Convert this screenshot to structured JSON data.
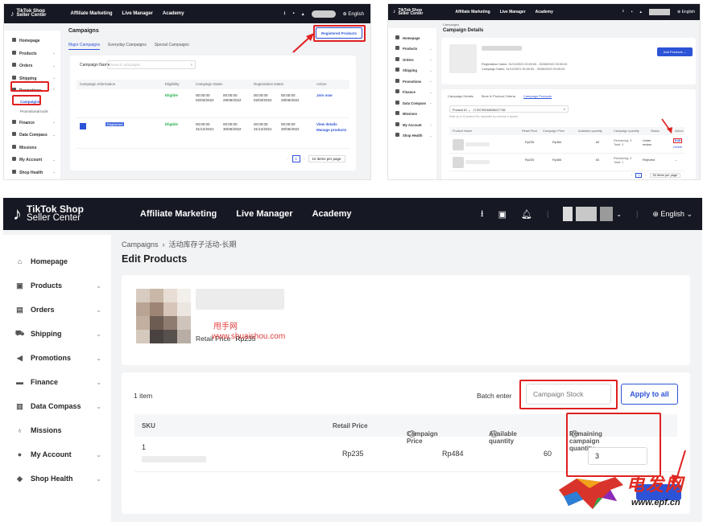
{
  "panel1": {
    "logo": {
      "line1": "TikTok Shop",
      "line2": "Seller Center"
    },
    "nav": [
      "Affiliate Marketing",
      "Live Manager",
      "Academy"
    ],
    "language": "English",
    "sidebar": [
      "Homepage",
      "Products",
      "Orders",
      "Shipping",
      "Promotions",
      "Finance",
      "Data Compass",
      "Missions",
      "My Account",
      "Shop Health"
    ],
    "sub_items": [
      "Campaigns",
      "Promotional tools"
    ],
    "title": "Campaigns",
    "registered_btn": "Registered Products",
    "tabs": [
      "Major Campaigns",
      "Everyday Campaigns",
      "Special Campaigns"
    ],
    "search_label": "Campaign Name",
    "search_placeholder": "Search campaigns",
    "columns": [
      "Campaign Information",
      "Eligibility",
      "Campaign Dates",
      "Registration Dates",
      "Action"
    ],
    "rows": [
      {
        "eligibility": "Eligible",
        "c_start": "00:00:00 02/03/2022",
        "c_end": "00:00:00 29/06/2022",
        "r_start": "00:00:00 02/03/2022",
        "r_end": "00:00:00 29/06/2022",
        "action": "Join now",
        "badge": ""
      },
      {
        "eligibility": "Eligible",
        "c_start": "00:00:00 31/12/2021",
        "c_end": "00:00:00 30/06/2022",
        "r_start": "00:00:00 31/12/2021",
        "r_end": "00:00:00 30/06/2022",
        "action": "View details",
        "action2": "Manage products",
        "badge": "Registered"
      }
    ],
    "page": "1",
    "per_page": "10 items per page"
  },
  "panel2": {
    "logo": {
      "line1": "TikTok Shop",
      "line2": "Seller Center"
    },
    "nav": [
      "Affiliate Marketing",
      "Live Manager",
      "Academy"
    ],
    "language": "English",
    "sidebar": [
      "Homepage",
      "Products",
      "Orders",
      "Shipping",
      "Promotions",
      "Finance",
      "Data Compass",
      "Missions",
      "My Account",
      "Shop Health"
    ],
    "breadcrumb": "Campaigns",
    "title": "Campaign Details",
    "reg_dates": "Registration Dates: 31/12/2021 00:00:00 - 30/06/2022 00:00:00",
    "camp_dates": "Campaign Dates: 31/12/2021 00:00:00 - 30/06/2022 00:00:00",
    "add_btn": "Add Products",
    "tabs": [
      "Campaign Details",
      "Store & Product Criteria",
      "Campaign Products"
    ],
    "filter_label": "Product ID",
    "filter_value": "1729749248636227738",
    "hint": "Enter up to 10 product IDs, separated by commas or spaces",
    "columns": [
      "Product Name",
      "Retail Price",
      "Campaign Price",
      "Available quantity",
      "Campaign quantity",
      "Status",
      "Action"
    ],
    "rows": [
      {
        "retail": "Rp235",
        "campaign": "Rp484",
        "available": "60",
        "remaining": "Remaining: 3 Total: 3",
        "status": "Under review",
        "action": "Edit",
        "action2": "Delete"
      },
      {
        "retail": "Rp235",
        "campaign": "Rp466",
        "available": "60",
        "remaining": "Remaining: 0 Total: 1",
        "status": "Rejected",
        "action": "--"
      }
    ],
    "page": "1",
    "per_page": "50 items per page"
  },
  "main": {
    "logo": {
      "line1": "TikTok Shop",
      "line2": "Seller Center"
    },
    "nav": [
      "Affiliate Marketing",
      "Live Manager",
      "Academy"
    ],
    "language": "English",
    "sidebar": [
      {
        "label": "Homepage",
        "icon": "home-icon",
        "chevron": false
      },
      {
        "label": "Products",
        "icon": "box-icon",
        "chevron": true
      },
      {
        "label": "Orders",
        "icon": "list-icon",
        "chevron": true
      },
      {
        "label": "Shipping",
        "icon": "truck-icon",
        "chevron": true
      },
      {
        "label": "Promotions",
        "icon": "megaphone-icon",
        "chevron": true
      },
      {
        "label": "Finance",
        "icon": "card-icon",
        "chevron": true
      },
      {
        "label": "Data Compass",
        "icon": "bar-chart-icon",
        "chevron": true
      },
      {
        "label": "Missions",
        "icon": "medal-icon",
        "chevron": false
      },
      {
        "label": "My Account",
        "icon": "user-icon",
        "chevron": true
      },
      {
        "label": "Shop Health",
        "icon": "shield-icon",
        "chevron": true
      }
    ],
    "breadcrumb": {
      "root": "Campaigns",
      "current": "活动库存子活动-长期"
    },
    "page_title": "Edit Products",
    "retail_label": "Retail Price",
    "retail_value": "Rp235",
    "watermark_line1": "甩手网",
    "watermark_line2": "www.shuaishou.com",
    "item_count": "1 item",
    "batch_label": "Batch enter",
    "stock_placeholder": "Campaign Stock",
    "apply_label": "Apply to all",
    "columns": {
      "sku": "SKU",
      "retail": "Retail Price",
      "campaign": "Campaign Price",
      "available": "Available quantity",
      "remaining": "Remaining campaign quantity"
    },
    "row": {
      "sku": "1",
      "retail": "Rp235",
      "campaign": "Rp484",
      "available": "60",
      "remaining": "3"
    },
    "overlay_brand": "电发网",
    "overlay_url": "www.epf.cn"
  },
  "colors": {
    "topbar": "#161823",
    "accent": "#2d53d6",
    "highlight": "#e02020",
    "eligible": "#22b14c"
  }
}
